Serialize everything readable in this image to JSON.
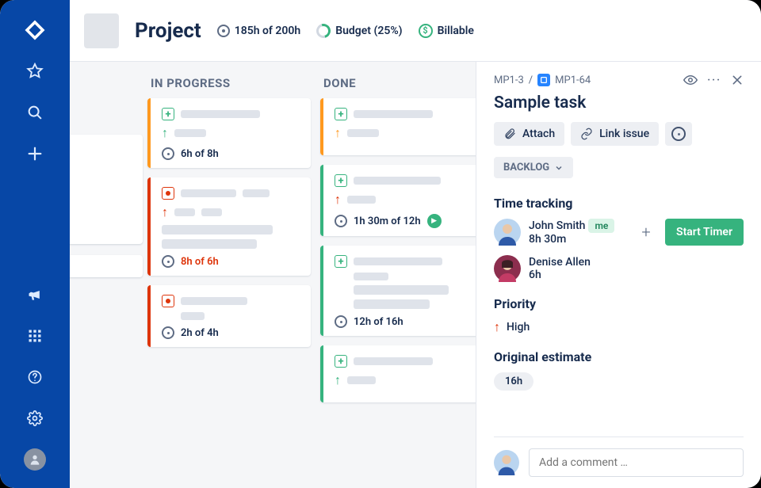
{
  "header": {
    "title": "Project",
    "time_stat": "185h of 200h",
    "budget_label": "Budget (25%)",
    "billable_label": "Billable"
  },
  "sidebar": {
    "icons": [
      "atlassian-icon",
      "star-icon",
      "search-icon",
      "plus-icon"
    ],
    "bottom_icons": [
      "megaphone-icon",
      "grid-apps-icon",
      "help-icon",
      "settings-icon",
      "user-avatar"
    ]
  },
  "board": {
    "columns": [
      {
        "title": "IN PROGRESS",
        "cards": [
          {
            "stripe": "orange",
            "icon": "plus",
            "arrow": "green",
            "time": "6h of 8h",
            "over": false
          },
          {
            "stripe": "red",
            "icon": "dot",
            "arrow": "red",
            "time": "8h of 6h",
            "over": true,
            "tall": true
          },
          {
            "stripe": "red",
            "icon": "dot",
            "arrow": "none",
            "time": "2h of 4h",
            "over": false
          }
        ]
      },
      {
        "title": "DONE",
        "cards": [
          {
            "stripe": "orange",
            "icon": "plus",
            "arrow": "orange",
            "time": "",
            "nofoot": true
          },
          {
            "stripe": "green",
            "icon": "plus",
            "arrow": "red",
            "time": "1h 30m of 12h",
            "play": true
          },
          {
            "stripe": "green",
            "icon": "plus",
            "arrow": "none",
            "time": "12h of 16h",
            "tall": true
          },
          {
            "stripe": "green",
            "icon": "plus",
            "arrow": "green",
            "time": "",
            "nofoot": true
          }
        ]
      }
    ]
  },
  "detail": {
    "breadcrumb": {
      "parent": "MP1-3",
      "sep": "/",
      "id": "MP1-64"
    },
    "title": "Sample task",
    "buttons": {
      "attach": "Attach",
      "link": "Link issue"
    },
    "status": "BACKLOG",
    "time_tracking_label": "Time tracking",
    "assignees": [
      {
        "name": "John Smith",
        "time": "8h 30m",
        "me": true
      },
      {
        "name": "Denise Allen",
        "time": "6h",
        "me": false
      }
    ],
    "me_badge_label": "me",
    "start_timer": "Start Timer",
    "priority_label": "Priority",
    "priority_value": "High",
    "estimate_label": "Original estimate",
    "estimate_value": "16h",
    "comment_placeholder": "Add a comment …"
  }
}
